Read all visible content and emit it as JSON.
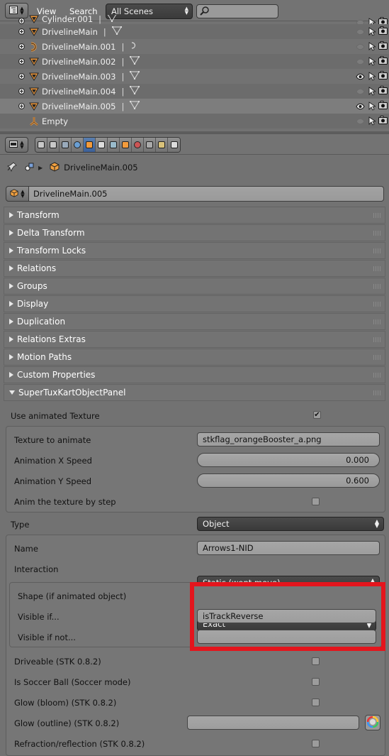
{
  "outliner": {
    "view_menu": "View",
    "search_menu": "Search",
    "scene_filter": "All Scenes",
    "search_placeholder": "",
    "rows": [
      {
        "name": "Cylinder.001",
        "type": "mesh",
        "visible": false
      },
      {
        "name": "DrivelineMain",
        "type": "mesh",
        "visible": false
      },
      {
        "name": "DrivelineMain.001",
        "type": "curve",
        "visible": false
      },
      {
        "name": "DrivelineMain.002",
        "type": "mesh",
        "visible": false
      },
      {
        "name": "DrivelineMain.003",
        "type": "mesh",
        "visible": true
      },
      {
        "name": "DrivelineMain.004",
        "type": "mesh",
        "visible": false
      },
      {
        "name": "DrivelineMain.005",
        "type": "mesh",
        "visible": true,
        "selected": true
      },
      {
        "name": "Empty",
        "type": "empty",
        "visible": false
      }
    ]
  },
  "properties": {
    "tabs": [
      "render-icon",
      "render-layers-icon",
      "scene-icon",
      "world-icon",
      "object-icon",
      "constraints-icon",
      "modifiers-icon",
      "data-icon",
      "material-icon",
      "texture-icon",
      "particles-icon",
      "physics-icon"
    ],
    "active_tab": 4,
    "breadcrumb": "DrivelineMain.005",
    "object_name": "DrivelineMain.005",
    "collapsed_panels": [
      "Transform",
      "Delta Transform",
      "Transform Locks",
      "Relations",
      "Groups",
      "Display",
      "Duplication",
      "Relations Extras",
      "Motion Paths",
      "Custom Properties"
    ],
    "stk_panel": {
      "title": "SuperTuxKartObjectPanel",
      "use_animated_texture": {
        "label": "Use animated Texture",
        "checked": true
      },
      "texture_to_animate": {
        "label": "Texture to animate",
        "value": "stkflag_orangeBooster_a.png"
      },
      "anim_x": {
        "label": "Animation X Speed",
        "value": "0.000"
      },
      "anim_y": {
        "label": "Animation Y Speed",
        "value": "0.600"
      },
      "anim_by_step": {
        "label": "Anim the texture by step",
        "checked": false
      },
      "type": {
        "label": "Type",
        "value": "Object"
      },
      "name": {
        "label": "Name",
        "value": "Arrows1-NID"
      },
      "interaction": {
        "label": "Interaction",
        "value": "Static (wont move)"
      },
      "shape": {
        "label": "Shape (if animated object)",
        "value": "Exact"
      },
      "visible_if": {
        "label": "Visible if...",
        "value": "isTrackReverse"
      },
      "visible_if_not": {
        "label": "Visible if not...",
        "value": ""
      },
      "driveable": {
        "label": "Driveable (STK 0.8.2)",
        "checked": false
      },
      "soccer_ball": {
        "label": "Is Soccer Ball (Soccer mode)",
        "checked": false
      },
      "glow_bloom": {
        "label": "Glow (bloom) (STK 0.8.2)",
        "checked": false
      },
      "glow_outline": {
        "label": "Glow (outline) (STK 0.8.2)",
        "value": ""
      },
      "refraction": {
        "label": "Refraction/reflection (STK 0.8.2)",
        "checked": false
      }
    },
    "highlight_color": "#e4151d"
  }
}
